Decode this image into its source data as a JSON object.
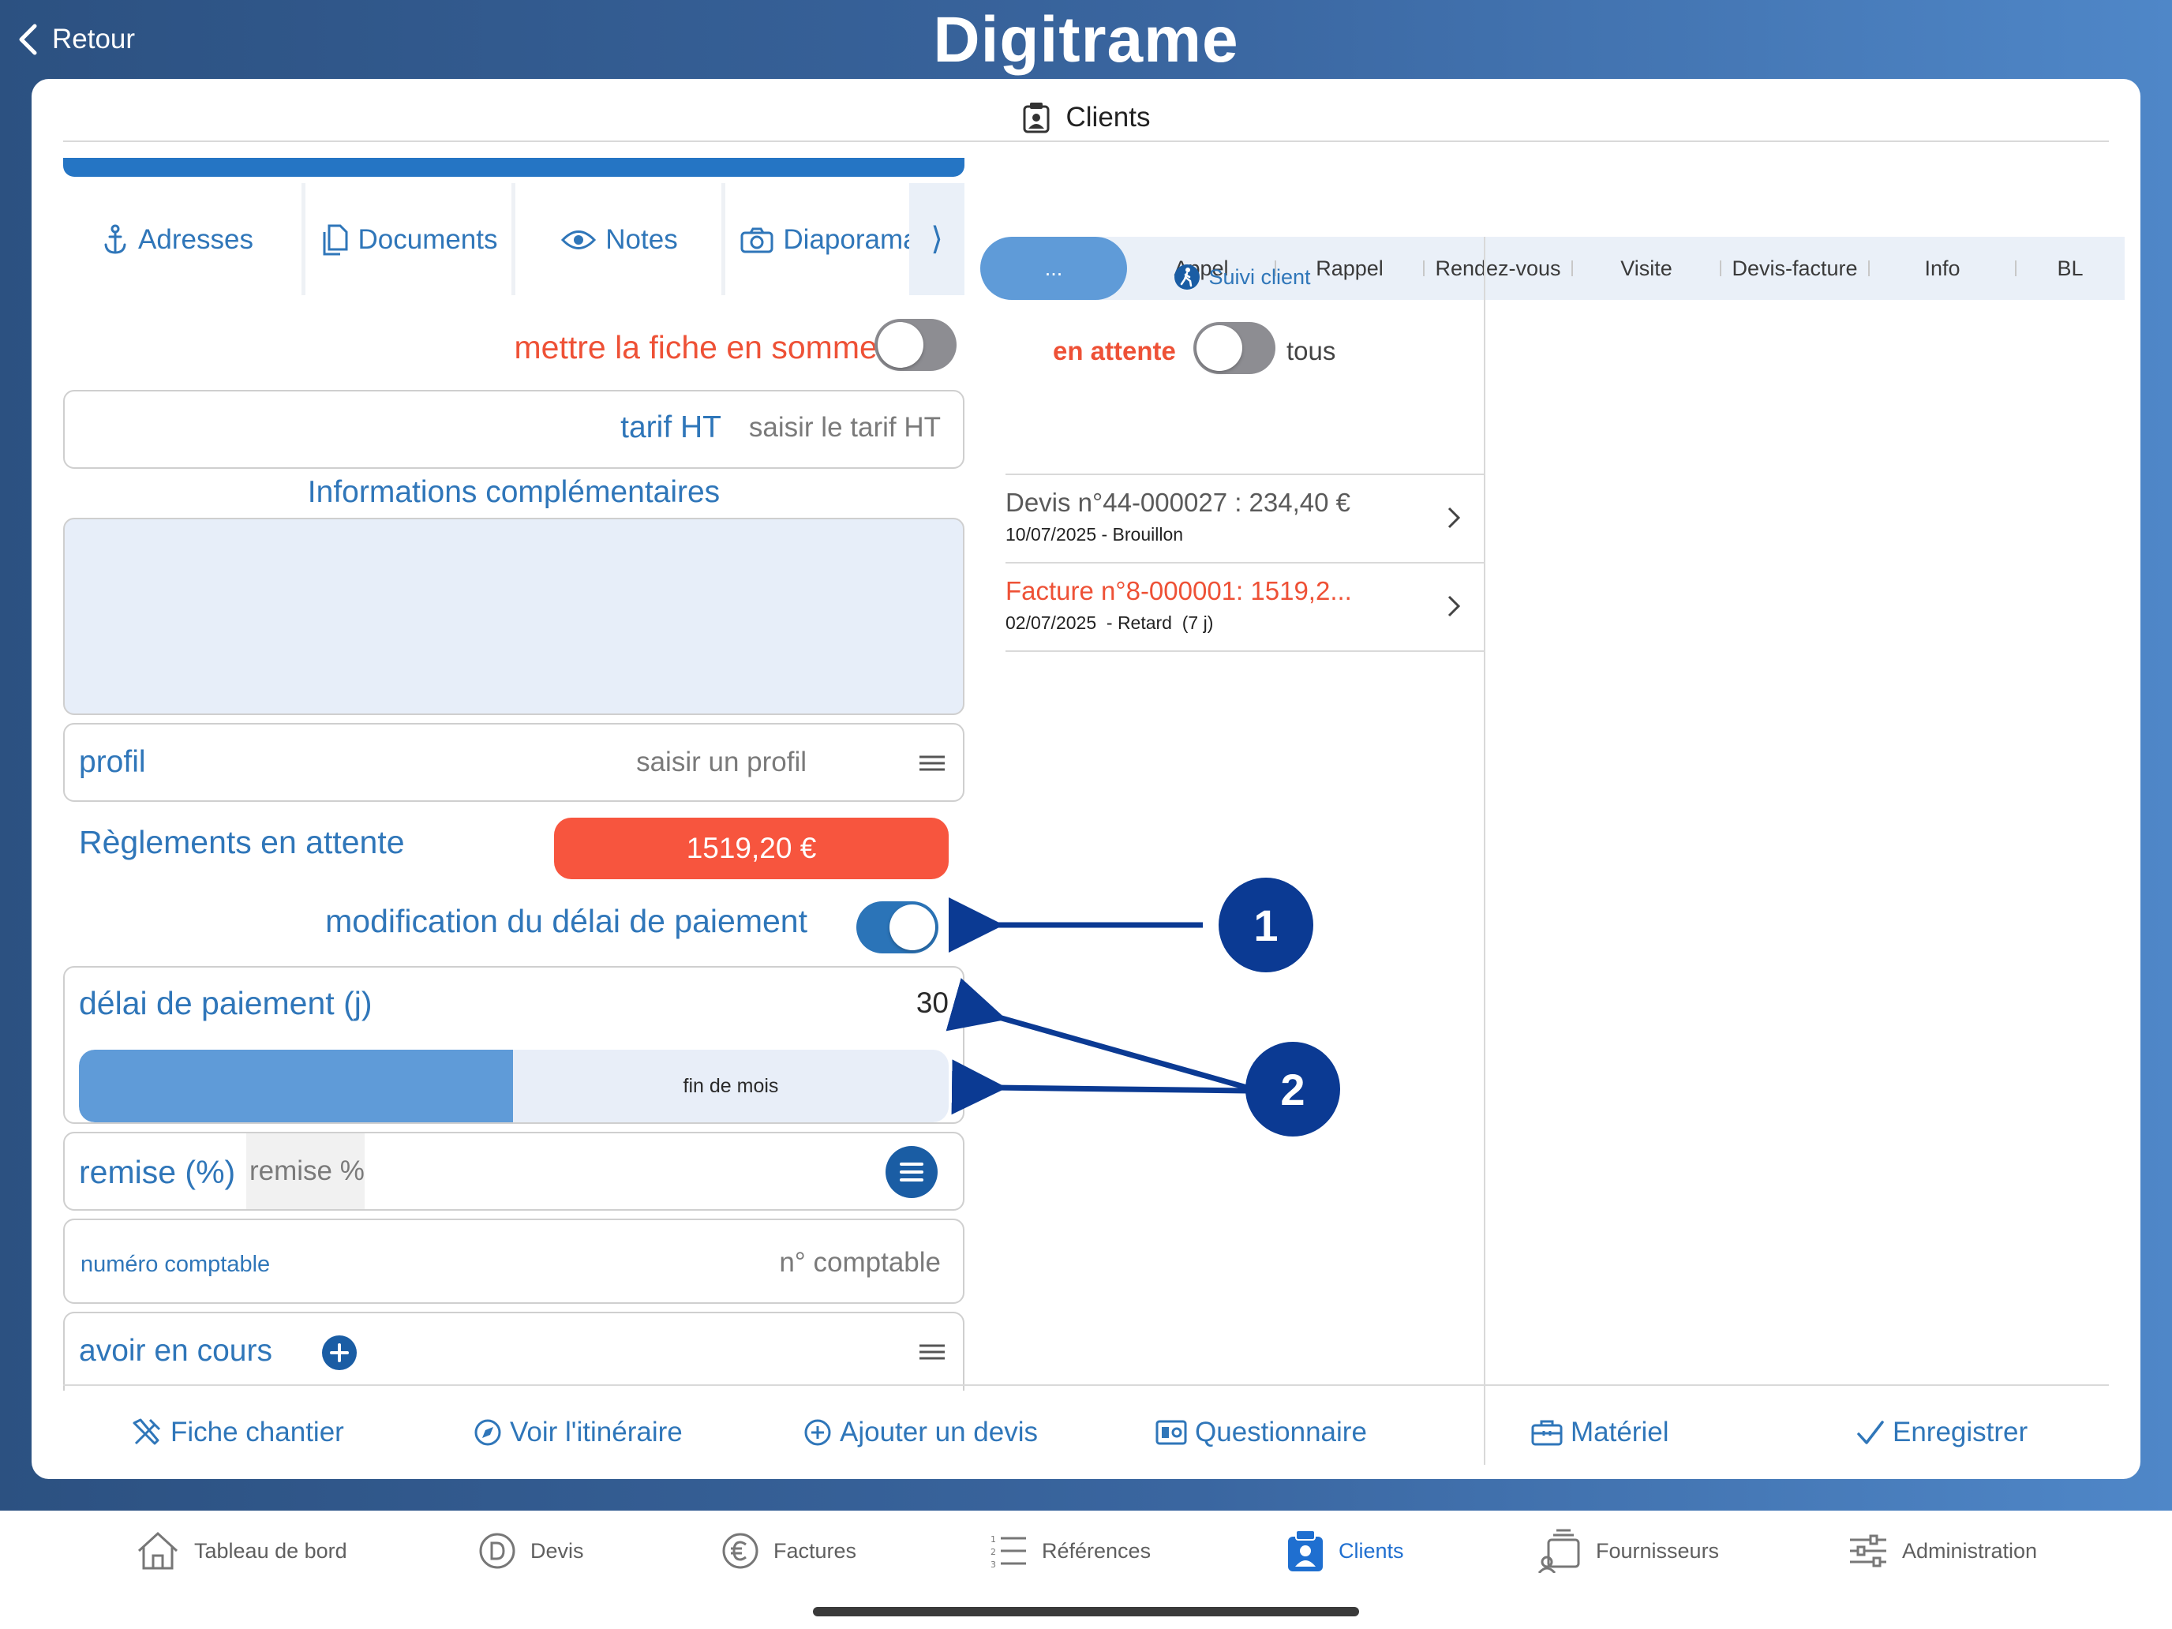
{
  "topbar": {
    "back_label": "Retour",
    "logo_text": "Digitrame"
  },
  "header": {
    "title": "Clients"
  },
  "tabs": [
    {
      "label": "Adresses",
      "icon": "anchor-icon"
    },
    {
      "label": "Documents",
      "icon": "documents-icon"
    },
    {
      "label": "Notes",
      "icon": "eye-icon"
    },
    {
      "label": "Diaporama",
      "icon": "camera-icon"
    }
  ],
  "tabs_more": "⟩",
  "left": {
    "sleep_label": "mettre la fiche en sommeil",
    "tarif_label": "tarif HT",
    "tarif_placeholder": "saisir le tarif HT",
    "info_title": "Informations complémentaires",
    "profil_label": "profil",
    "profil_placeholder": "saisir un profil",
    "reglements_label": "Règlements en attente",
    "reglements_amount": "1519,20 €",
    "modif_delai_label": "modification du délai de paiement",
    "delai_label": "délai de paiement (j)",
    "delai_value": "30",
    "fin_de_mois_label": "fin de mois",
    "remise_label": "remise (%)",
    "remise_placeholder": "remise %",
    "numero_label": "numéro comptable",
    "numero_placeholder": "n° comptable",
    "avoir_label": "avoir en cours"
  },
  "right": {
    "segments": [
      "...",
      "Appel",
      "Rappel",
      "Rendez-vous",
      "Visite",
      "Devis-facture",
      "Info",
      "BL"
    ],
    "suivi_label": "Suivi client",
    "en_attente_label": "en attente",
    "tous_label": "tous",
    "documents": [
      {
        "title": "Devis n°44-000027 : 234,40 €",
        "subtitle": "10/07/2025 - Brouillon",
        "status": "normal"
      },
      {
        "title": "Facture n°8-000001: 1519,2...",
        "subtitle": "02/07/2025  - Retard  (7 j)",
        "status": "late"
      }
    ]
  },
  "actions": [
    {
      "label": "Fiche chantier",
      "icon": "tools-icon"
    },
    {
      "label": "Voir l'itinéraire",
      "icon": "compass-icon"
    },
    {
      "label": "Ajouter un devis",
      "icon": "plus-circle-icon"
    },
    {
      "label": "Questionnaire",
      "icon": "form-icon"
    },
    {
      "label": "Matériel",
      "icon": "toolbox-icon"
    },
    {
      "label": "Enregistrer",
      "icon": "check-icon"
    }
  ],
  "nav": [
    {
      "label": "Tableau de bord",
      "icon": "home-icon"
    },
    {
      "label": "Devis",
      "icon": "devis-icon"
    },
    {
      "label": "Factures",
      "icon": "euro-icon"
    },
    {
      "label": "Références",
      "icon": "list-icon"
    },
    {
      "label": "Clients",
      "icon": "clients-icon",
      "active": true
    },
    {
      "label": "Fournisseurs",
      "icon": "suppliers-icon"
    },
    {
      "label": "Administration",
      "icon": "sliders-icon"
    }
  ],
  "annotations": [
    "1",
    "2"
  ],
  "colors": {
    "accent": "#2f76b9",
    "alert": "#ee5136",
    "annotation": "#0b3a93",
    "toggle_on": "#2b74b8"
  },
  "toggles": {
    "sommeil": false,
    "en_attente": false,
    "modif_delai": true
  }
}
